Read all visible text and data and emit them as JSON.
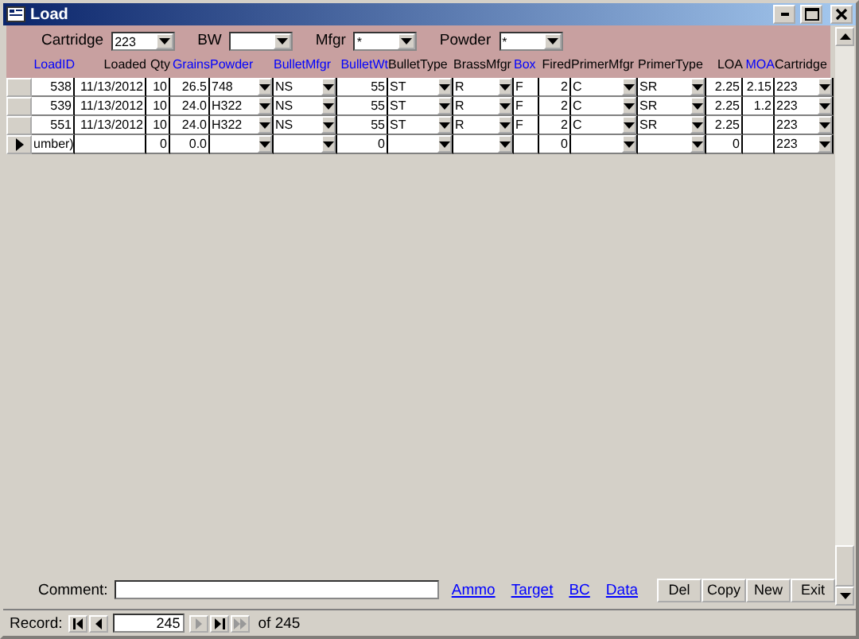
{
  "window": {
    "title": "Load"
  },
  "filters": [
    {
      "label": "Cartridge",
      "value": "223"
    },
    {
      "label": "BW"
    },
    {
      "label": "Mfgr",
      "value": "*"
    },
    {
      "label": "Powder",
      "value": "*"
    }
  ],
  "columns": [
    {
      "label": "LoadID",
      "kind": "text",
      "color": "#0000ff"
    },
    {
      "label": "Loaded",
      "kind": "text",
      "color": "#000000"
    },
    {
      "label": "Qty",
      "kind": "text",
      "color": "#000000"
    },
    {
      "label": "Grains",
      "kind": "text",
      "color": "#0000ff"
    },
    {
      "label": "Powder",
      "kind": "combo",
      "color": "#0000ff"
    },
    {
      "label": "BulletMfgr",
      "kind": "combo",
      "color": "#0000ff"
    },
    {
      "label": "BulletWt",
      "kind": "text",
      "color": "#0000ff"
    },
    {
      "label": "BulletType",
      "kind": "combo",
      "color": "#000000"
    },
    {
      "label": "BrassMfgr",
      "kind": "combo",
      "color": "#000000"
    },
    {
      "label": "Box",
      "kind": "left",
      "color": "#0000ff"
    },
    {
      "label": "Fired",
      "kind": "text",
      "color": "#000000"
    },
    {
      "label": "PrimerMfgr",
      "kind": "combo",
      "color": "#000000"
    },
    {
      "label": "PrimerType",
      "kind": "combo",
      "color": "#000000"
    },
    {
      "label": "LOA",
      "kind": "text",
      "color": "#000000"
    },
    {
      "label": "MOA",
      "kind": "text",
      "color": "#0000ff"
    },
    {
      "label": "Cartridge",
      "kind": "combo",
      "color": "#000000"
    }
  ],
  "rows": [
    {
      "selected": false,
      "cells": [
        "538",
        "11/13/2012",
        "10",
        "26.5",
        "748",
        "NS",
        "55",
        "ST",
        "R",
        "F",
        "2",
        "C",
        "SR",
        "2.25",
        "2.15",
        "223"
      ]
    },
    {
      "selected": false,
      "cells": [
        "539",
        "11/13/2012",
        "10",
        "24.0",
        "H322",
        "NS",
        "55",
        "ST",
        "R",
        "F",
        "2",
        "C",
        "SR",
        "2.25",
        "1.2",
        "223"
      ]
    },
    {
      "selected": false,
      "cells": [
        "551",
        "11/13/2012",
        "10",
        "24.0",
        "H322",
        "NS",
        "55",
        "ST",
        "R",
        "F",
        "2",
        "C",
        "SR",
        "2.25",
        "",
        "223"
      ]
    },
    {
      "selected": true,
      "cells": [
        "umber)",
        "",
        "0",
        "0.0",
        "",
        "",
        "0",
        "",
        "",
        "",
        "0",
        "",
        "",
        "0",
        "",
        "223"
      ]
    }
  ],
  "comment": {
    "label": "Comment:"
  },
  "links": [
    "Ammo",
    "Target",
    "BC",
    "Data"
  ],
  "buttons": [
    "Del",
    "Copy",
    "New",
    "Exit"
  ],
  "record_nav": {
    "label": "Record:",
    "value": "245",
    "total": "of 245"
  }
}
